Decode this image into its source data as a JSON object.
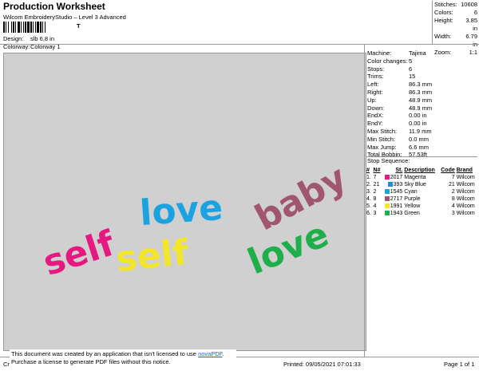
{
  "header": {
    "title": "Production Worksheet",
    "subtitle": "Wilcom EmbroideryStudio – Level 3 Advanced",
    "barcode_mark": "T",
    "design_label": "Design:",
    "design_value": "slb 6,8 in",
    "colorway_label": "Colorway:",
    "colorway_value": "Colorway 1"
  },
  "summary": [
    {
      "k": "Stitches:",
      "v": "10608"
    },
    {
      "k": "Colors:",
      "v": "6"
    },
    {
      "k": "Height:",
      "v": "3.85 in"
    },
    {
      "k": "Width:",
      "v": "6.79 in"
    },
    {
      "k": "Zoom:",
      "v": "1:1"
    }
  ],
  "machine_info": [
    {
      "k": "Machine:",
      "v": "Tajima"
    },
    {
      "k": "Color changes:",
      "v": "5"
    },
    {
      "k": "Stops:",
      "v": "6"
    },
    {
      "k": "Trims:",
      "v": "15"
    },
    {
      "k": "Left:",
      "v": "86.3 mm"
    },
    {
      "k": "Right:",
      "v": "86.3 mm"
    },
    {
      "k": "Up:",
      "v": "48.9 mm"
    },
    {
      "k": "Down:",
      "v": "48.9 mm"
    },
    {
      "k": "EndX:",
      "v": "0.00 in"
    },
    {
      "k": "EndY:",
      "v": "0.00 in"
    },
    {
      "k": "Max Stitch:",
      "v": "11.9 mm"
    },
    {
      "k": "Min Stitch:",
      "v": "0.0 mm"
    },
    {
      "k": "Max Jump:",
      "v": "6.6 mm"
    },
    {
      "k": "Total Bobbin:",
      "v": "57.53ft"
    }
  ],
  "stop_sequence": {
    "title": "Stop Sequence:",
    "headers": [
      "#",
      "N#",
      "St.",
      "Description",
      "Code",
      "Brand"
    ],
    "rows": [
      {
        "num": "1.",
        "n": "7",
        "st": "2017",
        "desc": "Magenta",
        "code": "7",
        "brand": "Wilcom",
        "color": "#e5197f"
      },
      {
        "num": "2.",
        "n": "21",
        "st": "393",
        "desc": "Sky Blue",
        "code": "21",
        "brand": "Wilcom",
        "color": "#1f8fd0"
      },
      {
        "num": "3.",
        "n": "2",
        "st": "1545",
        "desc": "Cyan",
        "code": "2",
        "brand": "Wilcom",
        "color": "#1aa3e0"
      },
      {
        "num": "4.",
        "n": "8",
        "st": "2717",
        "desc": "Purple",
        "code": "8",
        "brand": "Wilcom",
        "color": "#a0566e"
      },
      {
        "num": "5.",
        "n": "4",
        "st": "1991",
        "desc": "Yellow",
        "code": "4",
        "brand": "Wilcom",
        "color": "#f2e52a"
      },
      {
        "num": "6.",
        "n": "3",
        "st": "1943",
        "desc": "Green",
        "code": "3",
        "brand": "Wilcom",
        "color": "#1eae4a"
      }
    ]
  },
  "design_text": {
    "line1_part1": "self",
    "line1_part2": "love",
    "line1_part3": "baby",
    "line2_part1": "self",
    "line2_part2": "love"
  },
  "footer": {
    "notice_line1_prefix": "This document was created by an application that isn't licensed to use ",
    "notice_link": "novaPDF",
    "notice_line1_suffix": ".",
    "notice_line2": "Purchase a license to generate PDF files without this notice.",
    "left_text": "Cr",
    "printed": "Printed:  09/05/2021 07:01:33",
    "page": "Page 1 of 1"
  }
}
